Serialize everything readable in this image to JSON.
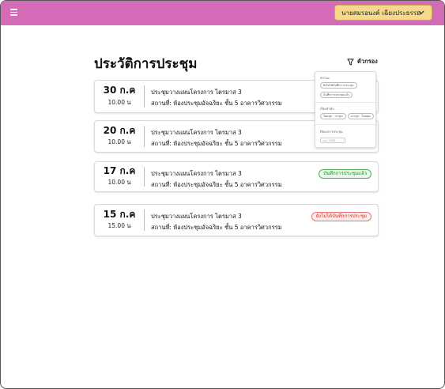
{
  "header": {
    "user_name": "นายสมรอนงค์ เฉียงประธรรม",
    "bg_color": "#d46bb8",
    "user_btn_color": "#f7d98d"
  },
  "page": {
    "title": "ประวัติการประชุม",
    "filter_label": "ตัวกรอง"
  },
  "filter_panel": {
    "status_title": "สถานะ",
    "status_options": [
      "ยังไม่ได้บันทึกการประชุม",
      "บันทึกการประชุมแล้ว"
    ],
    "sort_title": "เรียงลำดับ",
    "sort_options": [
      "ใหม่สุด - เก่าสุด",
      "เก่าสุด - ใหม่สุด"
    ],
    "date_title": "ปีของการประชุม",
    "date_placeholder": "เช่น 2568"
  },
  "meetings": [
    {
      "day": "30 ก.ค",
      "time": "10.00 น",
      "title": "ประชุมวางแผนโครงการ ไตรมาส 3",
      "location": "สถานที่: ห้องประชุมอัจฉริยะ ชั้น 5 อาคารวิศวกรรม",
      "status": ""
    },
    {
      "day": "20 ก.ค",
      "time": "10.00 น",
      "title": "ประชุมวางแผนโครงการ ไตรมาส 3",
      "location": "สถานที่: ห้องประชุมอัจฉริยะ ชั้น 5 อาคารวิศวกรรม",
      "status": ""
    },
    {
      "day": "17 ก.ค",
      "time": "10.00 น",
      "title": "ประชุมวางแผนโครงการ ไตรมาส 3",
      "location": "สถานที่: ห้องประชุมอัจฉริยะ ชั้น 5 อาคารวิศวกรรม",
      "status": "บันทึกการประชุมแล้ว"
    },
    {
      "day": "15 ก.ค",
      "time": "15.00 น",
      "title": "ประชุมวางแผนโครงการ ไตรมาส 3",
      "location": "สถานที่: ห้องประชุมอัจฉริยะ ชั้น 5 อาคารวิศวกรรม",
      "status": "ยังไม่ได้บันทึกการประชุม"
    }
  ]
}
